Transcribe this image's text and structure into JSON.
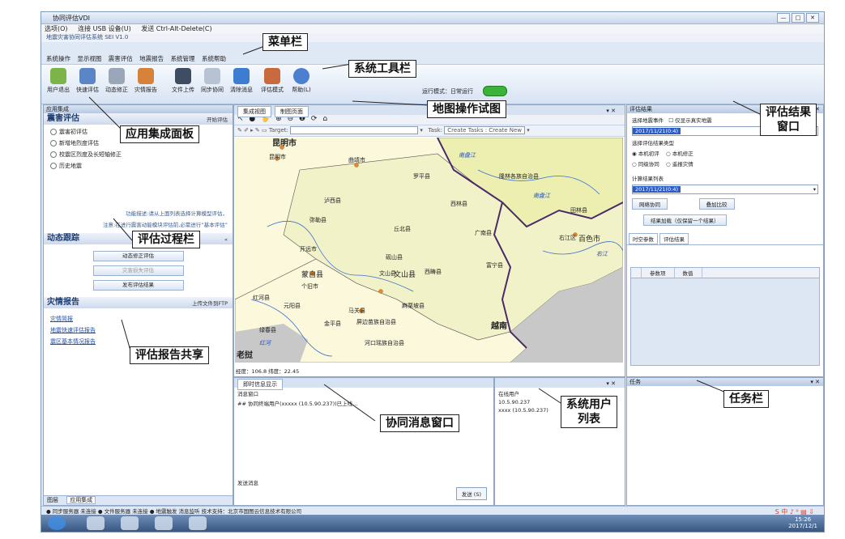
{
  "window": {
    "title": "协同评估VDI",
    "controls": [
      "—",
      "□",
      "✕"
    ]
  },
  "vdibar": {
    "options": "选项(O)",
    "usb": "连接 USB 设备(U)",
    "cad": "发送 Ctrl-Alt-Delete(C)"
  },
  "app": {
    "title": "地震灾害协同评估系统 SEI V1.0",
    "right": "_ ♂ ×"
  },
  "menu": {
    "items": [
      "系统操作",
      "显示视图",
      "震害评估",
      "地震报告",
      "系统管理",
      "系统帮助"
    ]
  },
  "toolbar": {
    "items": [
      "用户退出",
      "快速评估",
      "动态修正",
      "灾情报告",
      "文件上传",
      "同步协同",
      "清除消息",
      "评估模式",
      "帮助(L)"
    ],
    "run_mode_label": "运行模式：",
    "run_mode_value": "日常运行"
  },
  "left_panel": {
    "header": "应用集成",
    "earthquake": {
      "title": "震害评估",
      "action": "开始评估",
      "options": [
        "震害初评估",
        "新增地烈度评估",
        "校震区烈度及长短轴修正",
        "历史地震"
      ],
      "hint_lines": [
        "功能描述:请从上面列表选择计算模型评估，",
        "注意:在进行震害动能模块评估前,必需进行“基本评估”"
      ]
    },
    "dynamic": {
      "title": "动态跟踪",
      "buttons": [
        "动态修正评估",
        "灾害损失评估",
        "发布评估结果"
      ]
    },
    "report": {
      "title": "灾情报告",
      "action": "上传文件到FTP",
      "links": [
        "灾情简报",
        "地震快速评估报告",
        "震区基本情况报告"
      ]
    },
    "bottom_tabs": [
      "图层",
      "应用集成"
    ]
  },
  "map_panel": {
    "tabs": [
      "集成视图",
      "制图页面"
    ],
    "tools": "↖ ● ✋ ⊕ ⊖ ❶ ⟳ ⌂",
    "target_label": "Target:",
    "task_label": "Task:",
    "task_value": "Create Tasks : Create New",
    "coords": "经度：106.8 纬度：22.45",
    "places": [
      "昆明市",
      "昆明市",
      "曲靖市",
      "罗平县",
      "文山县",
      "文山县",
      "丘北县",
      "砚山县",
      "西畴县",
      "麻栗坡县",
      "马关县",
      "屏边苗族自治县",
      "河口瑶族自治县",
      "蒙自县",
      "个旧市",
      "开远市",
      "弥勒县",
      "泸西县",
      "红河县",
      "绿春县",
      "元阳县",
      "金平县",
      "富宁县",
      "广南县",
      "西林县",
      "隆林各族自治县",
      "右江区",
      "百色市",
      "田林县",
      "越南",
      "老挝"
    ],
    "rivers": [
      "南盘江",
      "南盘江",
      "红河",
      "右江"
    ]
  },
  "right_panel": {
    "header": "评估结果",
    "event_label": "选择地震事件",
    "only_real": "仅显示真实地震",
    "event_value": "2017/11/21(0:4)",
    "type_label": "选择评估结果类型",
    "types": [
      "本机初评",
      "本机修正",
      "同级协同",
      "遥报灾情"
    ],
    "list_label": "计算结果列表",
    "list_value": "2017/11/21(0:4)",
    "buttons": [
      "网络协同",
      "叠加比较",
      "结果加载（仅保留一个结果）"
    ],
    "sub_tabs": [
      "时空参数",
      "评估结果"
    ],
    "grid_cols": [
      "参数项",
      "数值"
    ]
  },
  "collab": {
    "tab": "即时信息显示",
    "sub": "消息窗口",
    "message": "## 协同终端用户(xxxxx (10.5.90.237))已上线...",
    "send_label": "发送消息",
    "send_button": "发送 (S)"
  },
  "users": {
    "title": "在线用户",
    "items": [
      "10.5.90.237",
      "xxxx (10.5.90.237)"
    ]
  },
  "task_panel": {
    "header": "任务"
  },
  "statusbar": {
    "text": "● 同步服务器 未连接  ● 文件服务器 未连接  ● 地震触发 消息监听        技术支持：北京市国图云信息技术有限公司"
  },
  "clock": {
    "time": "15:26",
    "date": "2017/12/1"
  },
  "annotations": [
    "菜单栏",
    "系统工具栏",
    "地图操作试图",
    "应用集成面板",
    "评估过程栏",
    "评估报告共享",
    "协同消息窗口",
    "系统用户列表",
    "评估结果窗口",
    "任务栏"
  ],
  "colors": {
    "frame": "#dfe8f5",
    "map_land": "#fbf8dc",
    "map_region": "#ecefb0",
    "map_sea": "#c8c8c8",
    "accent": "#2b5cc6"
  }
}
